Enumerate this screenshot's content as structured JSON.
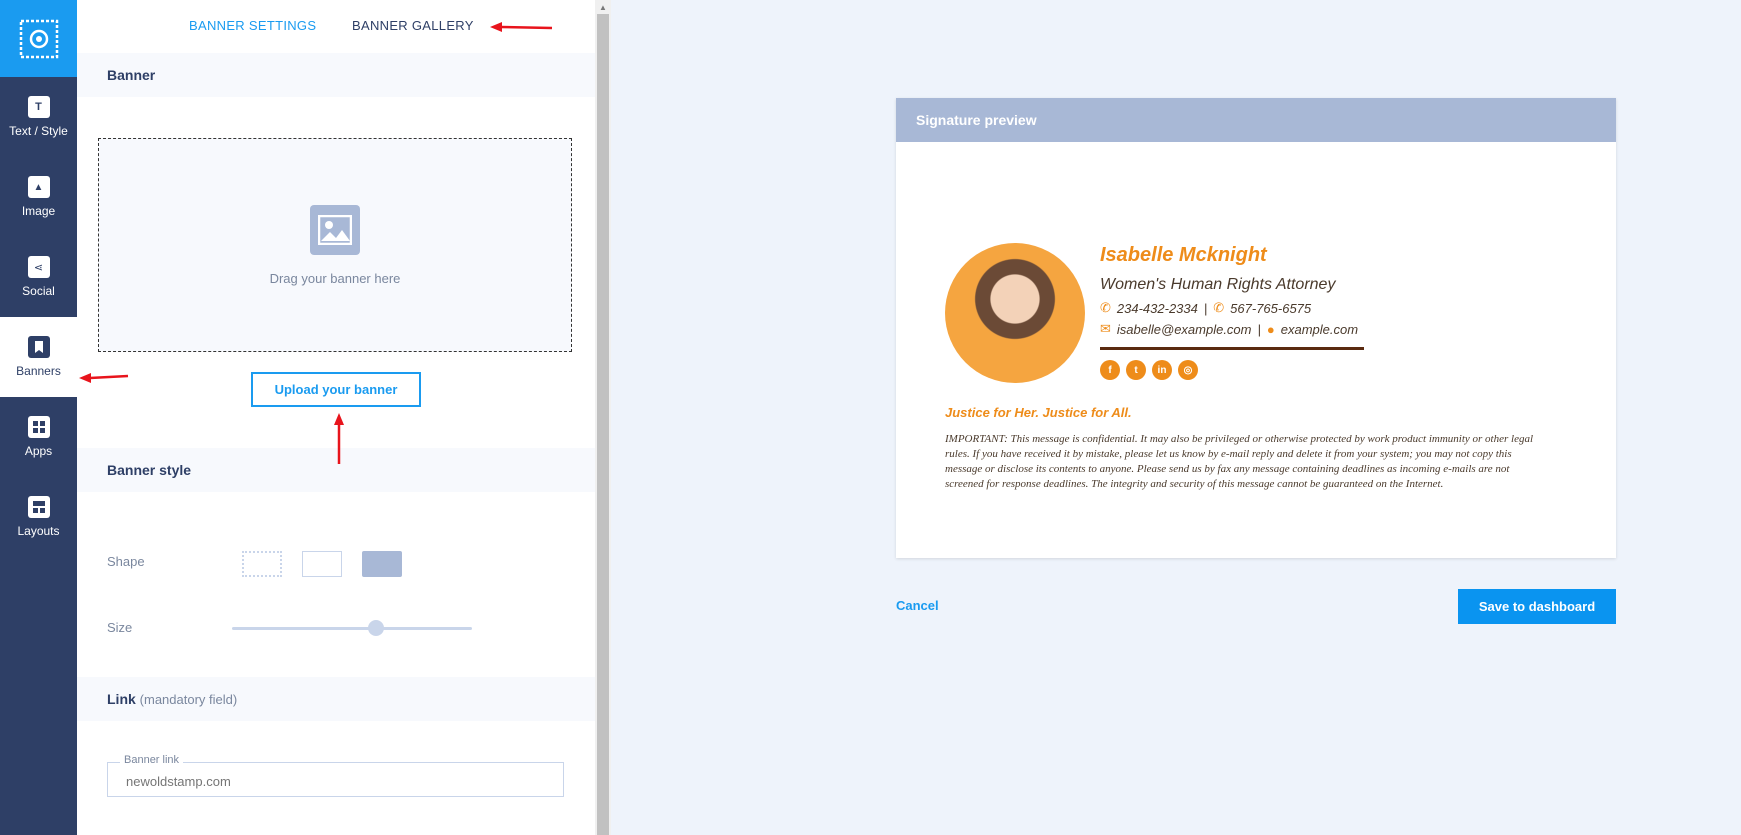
{
  "sidebar": {
    "items": [
      {
        "label": "Text / Style",
        "icon": "text-style-icon"
      },
      {
        "label": "Image",
        "icon": "image-icon"
      },
      {
        "label": "Social",
        "icon": "share-icon"
      },
      {
        "label": "Banners",
        "icon": "bookmark-icon",
        "active": true
      },
      {
        "label": "Apps",
        "icon": "apps-grid-icon"
      },
      {
        "label": "Layouts",
        "icon": "layout-icon"
      }
    ]
  },
  "tabs": {
    "settings": "BANNER SETTINGS",
    "gallery": "BANNER GALLERY"
  },
  "banner": {
    "heading": "Banner",
    "drop_text": "Drag your banner here",
    "upload_label": "Upload your banner"
  },
  "banner_style": {
    "heading": "Banner style",
    "shape_label": "Shape",
    "size_label": "Size",
    "size_value": 0.6
  },
  "link": {
    "heading": "Link",
    "note": "(mandatory field)",
    "field_label": "Banner link",
    "placeholder": "newoldstamp.com"
  },
  "preview": {
    "title": "Signature preview",
    "name": "Isabelle Mcknight",
    "job_title": "Women's Human Rights Attorney",
    "phone1": "234-432-2334",
    "phone2": "567-765-6575",
    "email": "isabelle@example.com",
    "website": "example.com",
    "separator": "|",
    "socials": [
      "facebook-icon",
      "twitter-icon",
      "linkedin-icon",
      "instagram-icon"
    ],
    "tagline": "Justice for Her. Justice for All.",
    "disclaimer": "IMPORTANT: This message is confidential. It may also be privileged or otherwise protected by work product immunity or other legal rules. If you have received it by mistake, please let us know by e-mail reply and delete it from your system; you may not copy this message or disclose its contents to anyone. Please send us by fax any message containing deadlines as incoming e-mails are not screened for response deadlines. The integrity and security of this message cannot be guaranteed on the Internet."
  },
  "actions": {
    "cancel": "Cancel",
    "save": "Save to dashboard"
  },
  "colors": {
    "accent": "#1a9bf0",
    "sidebar": "#2e3f66",
    "signature": "#ee8c1a",
    "annotation": "#e8141c"
  }
}
